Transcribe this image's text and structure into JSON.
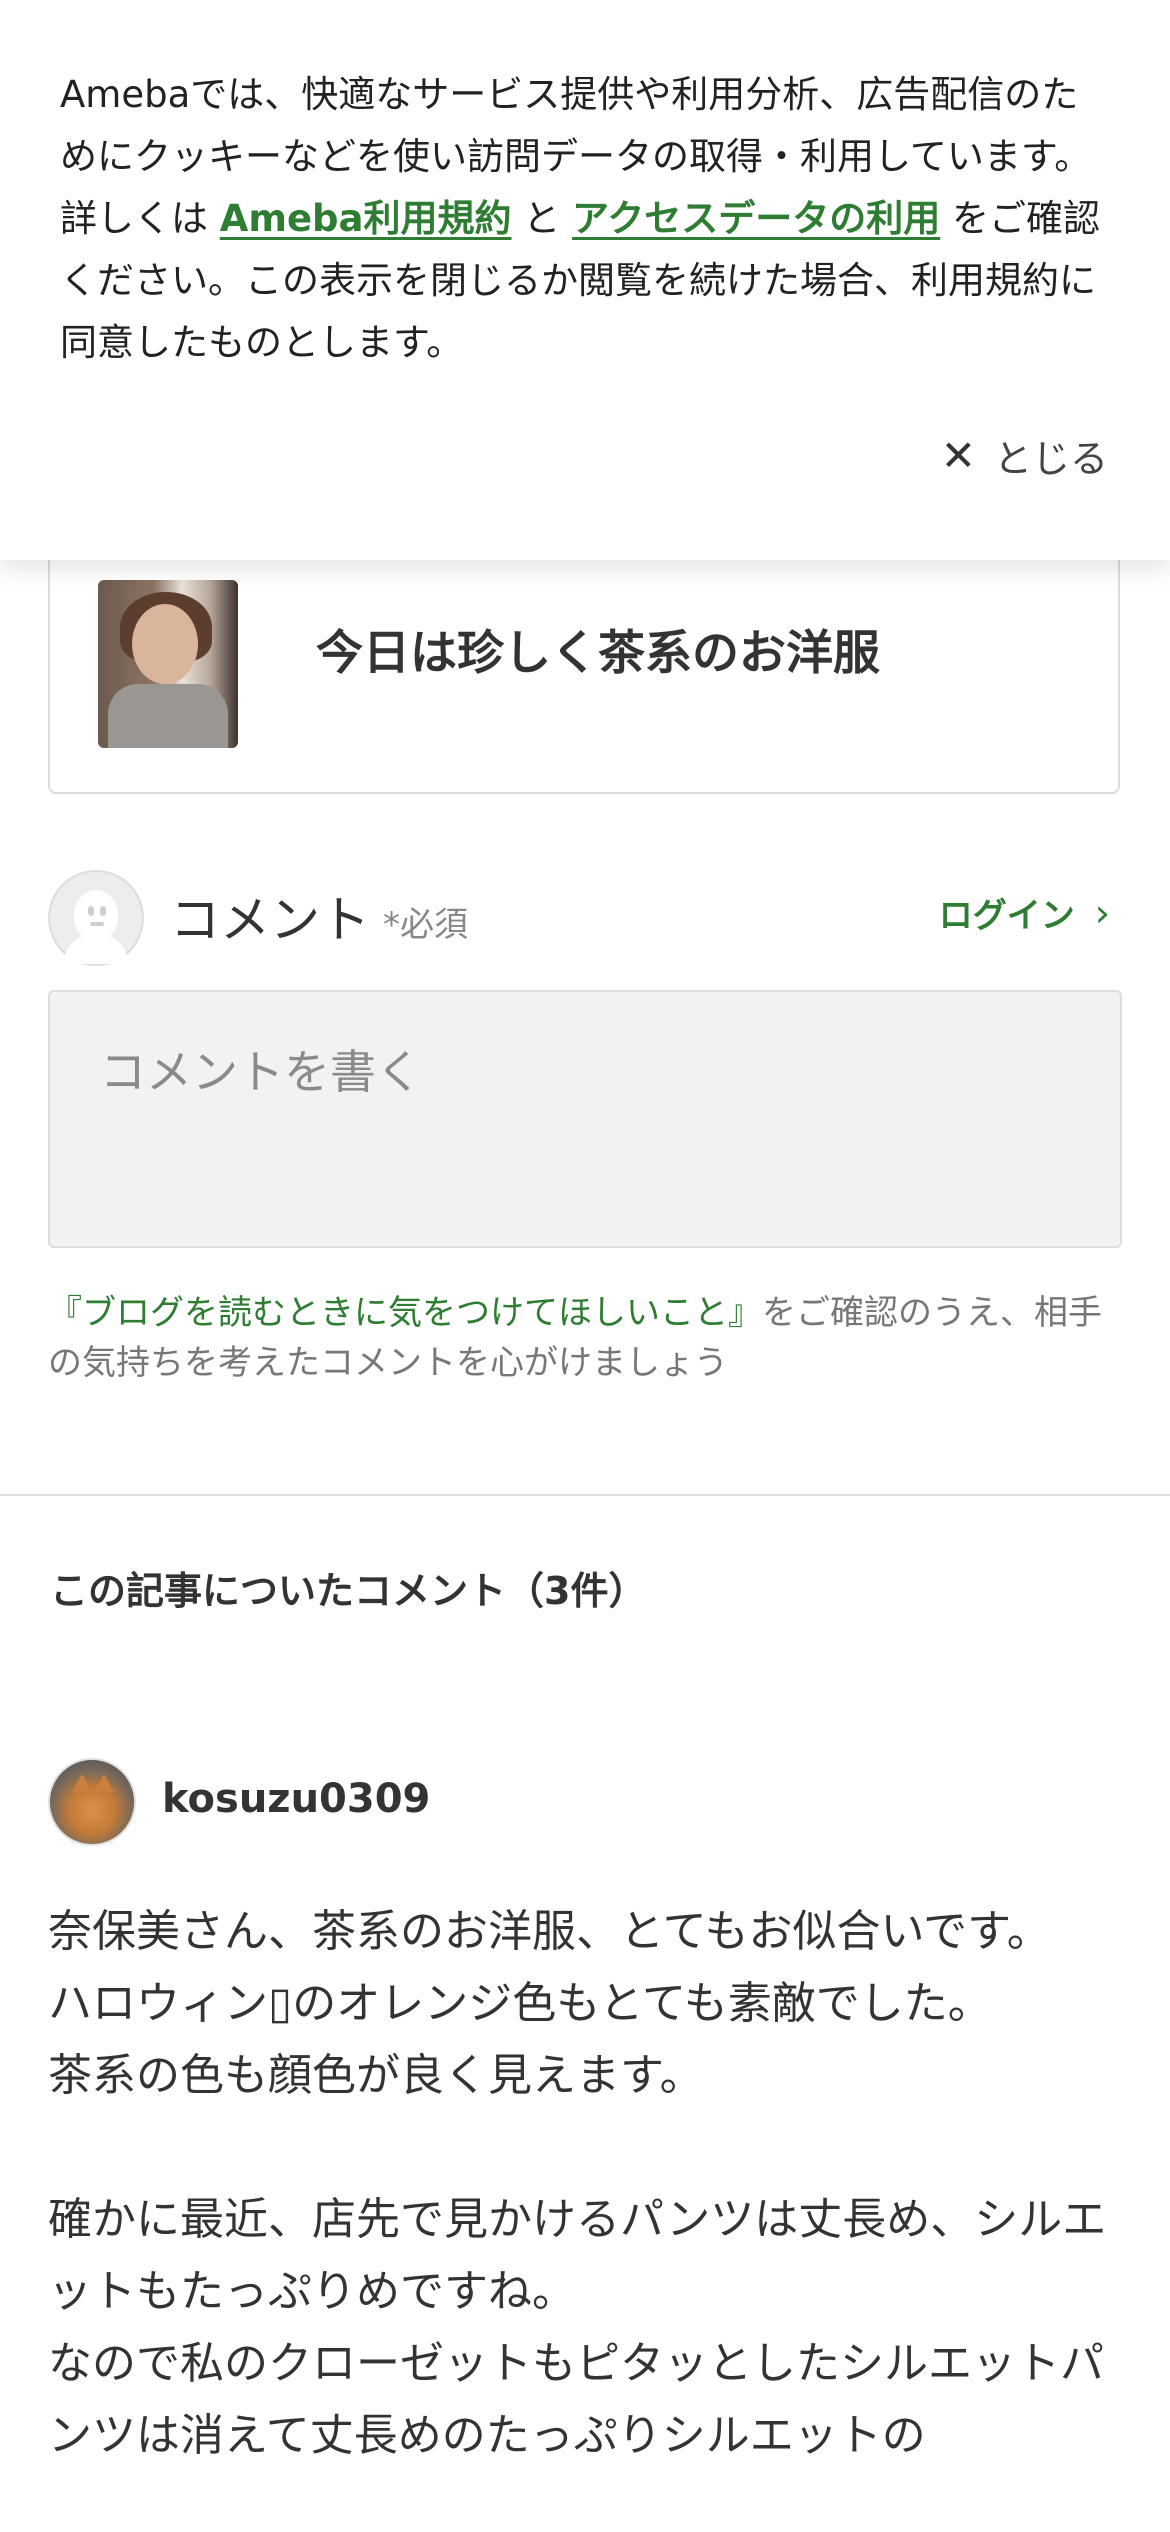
{
  "cookie_banner": {
    "text_before": "Amebaでは、快適なサービス提供や利用分析、広告配信のためにクッキーなどを使い訪問データの取得・利用しています。詳しくは ",
    "link1": "Ameba利用規約",
    "text_mid": " と ",
    "link2": "アクセスデータの利用",
    "text_after": " をご確認ください。この表示を閉じるか閲覧を続けた場合、利用規約に同意したものとします。",
    "close_icon": "close-icon",
    "close_label": "とじる"
  },
  "article": {
    "title": "今日は珍しく茶系のお洋服"
  },
  "comment_form": {
    "heading": "コメント",
    "required": "*必須",
    "login_label": "ログイン",
    "placeholder": "コメントを書く",
    "notice_link": "『ブログを読むときに気をつけてほしいこと』",
    "notice_text": "をご確認のうえ、相手の気持ちを考えたコメントを心がけましょう"
  },
  "comments": {
    "title": "この記事についたコメント（3件）",
    "items": [
      {
        "author": "kosuzu0309",
        "body": "奈保美さん、茶系のお洋服、とてもお似合いです。\nハロウィン▯のオレンジ色もとても素敵でした。\n茶系の色も顔色が良く見えます。\n\n確かに最近、店先で見かけるパンツは丈長め、シルエットもたっぷりめですね。\nなので私のクローゼットもピタッとしたシルエットパンツは消えて丈長めのたっぷりシルエットの"
      }
    ]
  },
  "colors": {
    "accent_green": "#2e7d32",
    "text": "#333333",
    "muted": "#888888"
  }
}
